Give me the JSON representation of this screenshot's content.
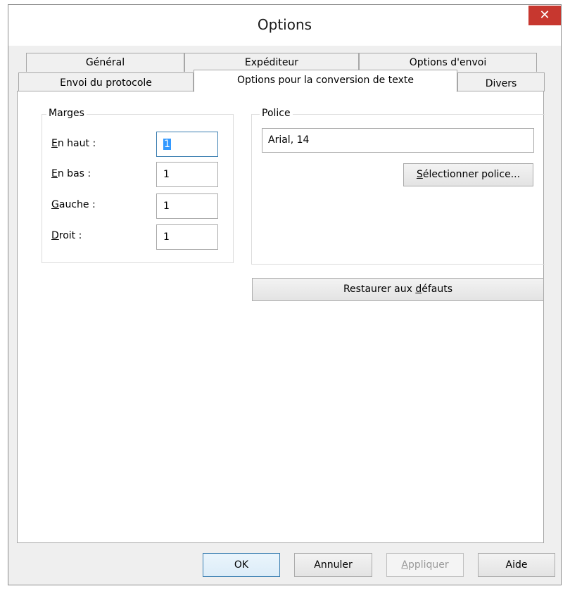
{
  "window": {
    "title": "Options",
    "close_label": "✕"
  },
  "tabs": {
    "row1": [
      "Général",
      "Expéditeur",
      "Options d'envoi"
    ],
    "row2": [
      "Envoi du protocole",
      "Options pour la conversion de texte",
      "Divers"
    ],
    "active": "Options pour la conversion de texte"
  },
  "margins": {
    "legend": "Marges",
    "top": {
      "accel": "E",
      "rest": "n haut :",
      "value": "1"
    },
    "bottom": {
      "accel": "E",
      "rest": "n bas :",
      "value": "1"
    },
    "left": {
      "accel": "G",
      "rest": "auche :",
      "value": "1"
    },
    "right": {
      "accel": "D",
      "rest": "roit :",
      "value": "1"
    }
  },
  "font": {
    "legend": "Police",
    "value": "Arial, 14",
    "select_button": {
      "accel": "S",
      "rest": "électionner police..."
    }
  },
  "restore_button": {
    "pre": "Restaurer aux ",
    "accel": "d",
    "post": "éfauts"
  },
  "footer": {
    "ok": "OK",
    "cancel": "Annuler",
    "apply": {
      "accel": "A",
      "rest": "ppliquer"
    },
    "help": "Aide"
  }
}
